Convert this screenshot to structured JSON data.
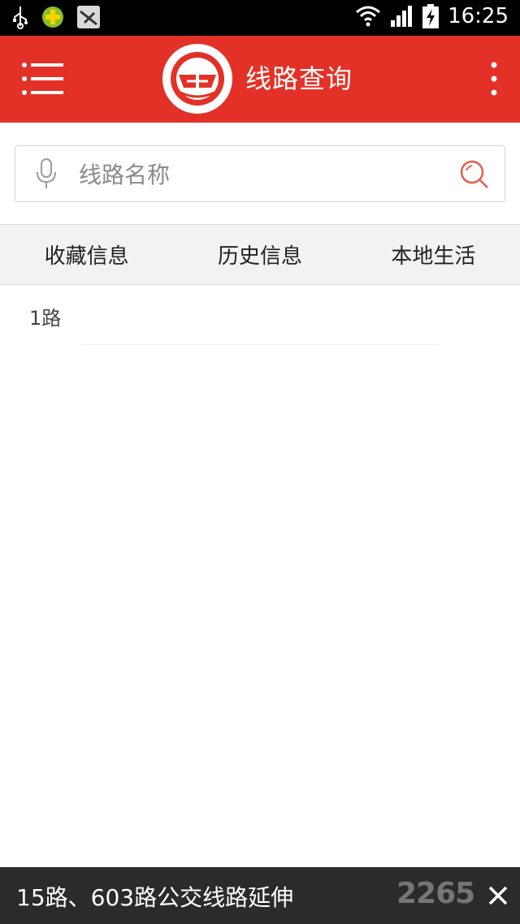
{
  "status_bar": {
    "time": "16:25",
    "icons": [
      "usb-icon",
      "app-plus-icon",
      "app-icon",
      "wifi-icon",
      "signal-icon",
      "battery-charging-icon"
    ]
  },
  "app_bar": {
    "title": "线路查询",
    "menu_icon": "hamburger-menu-icon",
    "overflow_icon": "more-vert-icon",
    "logo": "bus-company-logo"
  },
  "search": {
    "placeholder": "线路名称",
    "value": ""
  },
  "tabs": [
    {
      "label": "收藏信息"
    },
    {
      "label": "历史信息"
    },
    {
      "label": "本地生活"
    }
  ],
  "results": [
    {
      "label": "1路"
    }
  ],
  "banner": {
    "text": "15路、603路公交线路延伸",
    "watermark": "2265",
    "close_icon": "close-icon"
  },
  "colors": {
    "accent": "#e33127",
    "banner_bg": "#2b2b2b",
    "tab_bg": "#f2f2f0"
  }
}
